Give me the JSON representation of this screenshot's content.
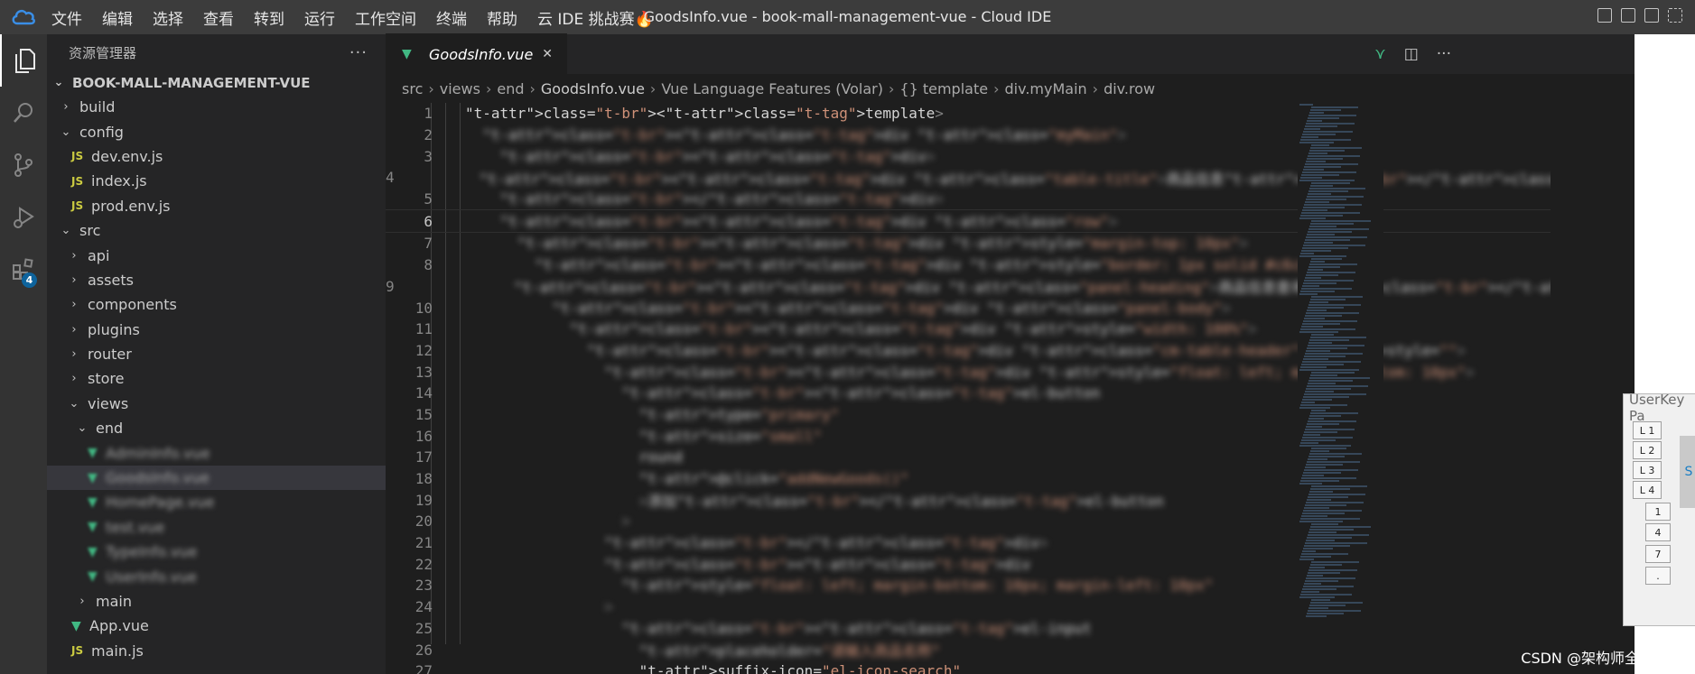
{
  "window": {
    "title": "GoodsInfo.vue - book-mall-management-vue - Cloud IDE"
  },
  "menu": [
    "文件",
    "编辑",
    "选择",
    "查看",
    "转到",
    "运行",
    "工作空间",
    "终端",
    "帮助",
    "云 IDE 挑战赛🔥"
  ],
  "activity": {
    "extensions_badge": "4"
  },
  "explorer": {
    "title": "资源管理器",
    "more": "···",
    "root": "BOOK-MALL-MANAGEMENT-VUE",
    "items": [
      {
        "label": "build",
        "type": "folder",
        "open": false,
        "depth": 0
      },
      {
        "label": "config",
        "type": "folder",
        "open": true,
        "depth": 0
      },
      {
        "label": "dev.env.js",
        "type": "js",
        "depth": 1
      },
      {
        "label": "index.js",
        "type": "js",
        "depth": 1
      },
      {
        "label": "prod.env.js",
        "type": "js",
        "depth": 1
      },
      {
        "label": "src",
        "type": "folder",
        "open": true,
        "depth": 0
      },
      {
        "label": "api",
        "type": "folder",
        "open": false,
        "depth": 1
      },
      {
        "label": "assets",
        "type": "folder",
        "open": false,
        "depth": 1
      },
      {
        "label": "components",
        "type": "folder",
        "open": false,
        "depth": 1
      },
      {
        "label": "plugins",
        "type": "folder",
        "open": false,
        "depth": 1
      },
      {
        "label": "router",
        "type": "folder",
        "open": false,
        "depth": 1
      },
      {
        "label": "store",
        "type": "folder",
        "open": false,
        "depth": 1
      },
      {
        "label": "views",
        "type": "folder",
        "open": true,
        "depth": 1
      },
      {
        "label": "end",
        "type": "folder",
        "open": true,
        "depth": 2
      },
      {
        "label": "AdminInfo.vue",
        "type": "vue",
        "depth": 3,
        "blur": true
      },
      {
        "label": "GoodsInfo.vue",
        "type": "vue",
        "depth": 3,
        "blur": true,
        "selected": true
      },
      {
        "label": "HomePage.vue",
        "type": "vue",
        "depth": 3,
        "blur": true
      },
      {
        "label": "test.vue",
        "type": "vue",
        "depth": 3,
        "blur": true
      },
      {
        "label": "TypeInfo.vue",
        "type": "vue",
        "depth": 3,
        "blur": true
      },
      {
        "label": "UserInfo.vue",
        "type": "vue",
        "depth": 3,
        "blur": true
      },
      {
        "label": "main",
        "type": "folder",
        "open": false,
        "depth": 2
      },
      {
        "label": "App.vue",
        "type": "vue",
        "depth": 1
      },
      {
        "label": "main.js",
        "type": "js",
        "depth": 1
      }
    ]
  },
  "tab": {
    "label": "GoodsInfo.vue",
    "close": "✕"
  },
  "breadcrumb": [
    "src",
    "views",
    "end",
    "GoodsInfo.vue",
    "Vue Language Features (Volar)",
    "{} template",
    "div.myMain",
    "div.row"
  ],
  "code": {
    "current_line": 6,
    "lines": [
      {
        "n": "1",
        "text": "<template>",
        "blur": false
      },
      {
        "n": "2",
        "text": "  <div class=\"myMain\">",
        "blur": true
      },
      {
        "n": "3",
        "text": "    <div>",
        "blur": true
      },
      {
        "n": "4",
        "text": "      <div class=\"table-title\">商品信息</div>",
        "blur": true
      },
      {
        "n": "5",
        "text": "    </div>",
        "blur": true
      },
      {
        "n": "6",
        "text": "    <div class=\"row\">",
        "blur": true
      },
      {
        "n": "7",
        "text": "      <div style=\"margin-top: 10px\">",
        "blur": true
      },
      {
        "n": "8",
        "text": "        <div style=\"border: 1px solid #c6c6c6\">",
        "blur": true
      },
      {
        "n": "9",
        "text": "          <div class=\"panel-heading\">商品信息查询</div>",
        "blur": true
      },
      {
        "n": "10",
        "text": "          <div class=\"panel-body\">",
        "blur": true
      },
      {
        "n": "11",
        "text": "            <div style=\"width: 100%\">",
        "blur": true
      },
      {
        "n": "12",
        "text": "              <div class=\"cm-table-header\" style=\"\">",
        "blur": true
      },
      {
        "n": "13",
        "text": "                <div style=\"float: left; margin-bottom: 10px\">",
        "blur": true
      },
      {
        "n": "14",
        "text": "                  <el-button",
        "blur": true
      },
      {
        "n": "15",
        "text": "                    type=\"primary\"",
        "blur": true
      },
      {
        "n": "16",
        "text": "                    size=\"small\"",
        "blur": true
      },
      {
        "n": "17",
        "text": "                    round",
        "blur": true
      },
      {
        "n": "18",
        "text": "                    @click=\"addNewGoods()\"",
        "blur": true
      },
      {
        "n": "19",
        "text": "                    >添加</el-button",
        "blur": true
      },
      {
        "n": "20",
        "text": "                  >",
        "blur": true
      },
      {
        "n": "21",
        "text": "                </div>",
        "blur": true
      },
      {
        "n": "22",
        "text": "                <div",
        "blur": true
      },
      {
        "n": "23",
        "text": "                  style=\"float: left; margin-bottom: 10px; margin-left: 10px\"",
        "blur": true
      },
      {
        "n": "24",
        "text": "                >",
        "blur": true
      },
      {
        "n": "25",
        "text": "                  <el-input",
        "blur": true
      },
      {
        "n": "26",
        "text": "                    placeholder=\"请输入商品名称\"",
        "blur": true
      },
      {
        "n": "27",
        "text": "                    suffix-icon=\"el-icon-search\"",
        "blur": false
      }
    ]
  },
  "userkey": {
    "title": "UserKey Pa",
    "buttons": [
      "L 1",
      "L 2",
      "L 3",
      "L 4",
      "1",
      "4",
      "7",
      "."
    ],
    "big_label": "S"
  },
  "watermark": "CSDN @架构师全栈之路"
}
